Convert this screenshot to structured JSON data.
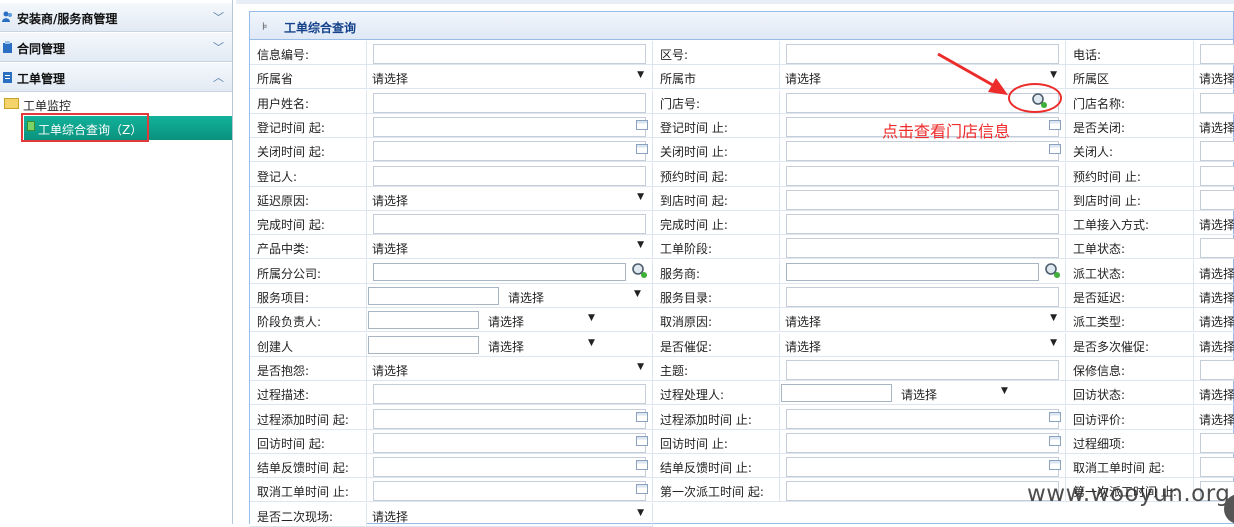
{
  "sidebar": {
    "installer_label": "安装商/服务商管理",
    "contract_label": "合同管理",
    "workorder_label": "工单管理",
    "folder_label": "工单监控",
    "active_leaf_label": "工单综合查询（Z）"
  },
  "panel": {
    "title": "工单综合查询"
  },
  "select_default": "请选择",
  "form": {
    "r0": [
      "信息编号:",
      "区号:",
      "电话:"
    ],
    "r1": [
      "所属省",
      "所属市",
      "所属区"
    ],
    "r2": [
      "用户姓名:",
      "门店号:",
      "门店名称:"
    ],
    "r3": [
      "登记时间  起:",
      "登记时间  止:",
      "是否关闭:"
    ],
    "r4": [
      "关闭时间  起:",
      "关闭时间  止:",
      "关闭人:"
    ],
    "r5": [
      "登记人:",
      "预约时间  起:",
      "预约时间  止:"
    ],
    "r6": [
      "延迟原因:",
      "到店时间  起:",
      "到店时间  止:"
    ],
    "r7": [
      "完成时间  起:",
      "完成时间  止:",
      "工单接入方式:"
    ],
    "r8": [
      "产品中类:",
      "工单阶段:",
      "工单状态:"
    ],
    "r9": [
      "所属分公司:",
      "服务商:",
      "派工状态:"
    ],
    "r10": [
      "服务项目:",
      "服务目录:",
      "是否延迟:"
    ],
    "r11": [
      "阶段负责人:",
      "取消原因:",
      "派工类型:"
    ],
    "r12": [
      "创建人",
      "是否催促:",
      "是否多次催促:"
    ],
    "r13": [
      "是否抱怨:",
      "主题:",
      "保修信息:"
    ],
    "r14": [
      "过程描述:",
      "过程处理人:",
      "回访状态:"
    ],
    "r15": [
      "过程添加时间  起:",
      "过程添加时间  止:",
      "回访评价:"
    ],
    "r16": [
      "回访时间  起:",
      "回访时间  止:",
      "过程细项:"
    ],
    "r17": [
      "结单反馈时间  起:",
      "结单反馈时间  止:",
      "取消工单时间  起:"
    ],
    "r18": [
      "取消工单时间  止:",
      "第一次派工时间  起:",
      "第一次派工时间  止:"
    ],
    "r19": [
      "是否二次现场:"
    ]
  },
  "annotation": {
    "text": "点击查看门店信息"
  },
  "watermark": {
    "text": "www.wooyun.org"
  },
  "colors": {
    "accent_teal": "#0ea58e",
    "annotation_red": "#ef2b2b",
    "panel_title": "#15428b"
  }
}
